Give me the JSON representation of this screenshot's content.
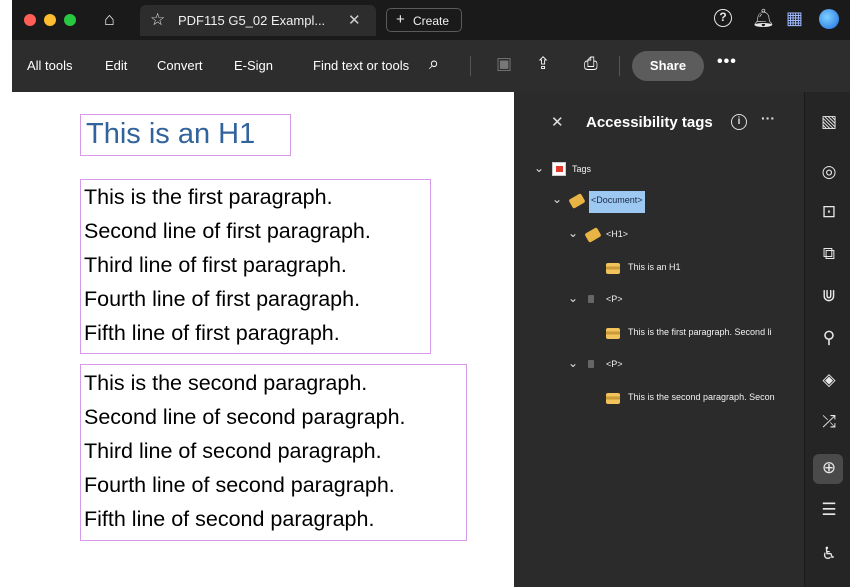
{
  "tabbar": {
    "tab_title": "PDF115 G5_02 Exampl...",
    "create_label": "Create",
    "help_glyph": "?"
  },
  "toolbar": {
    "all_tools": "All tools",
    "edit": "Edit",
    "convert": "Convert",
    "esign": "E-Sign",
    "find_text": "Find text or tools",
    "share": "Share"
  },
  "document": {
    "heading": "This is an H1",
    "paragraph1": [
      "This is the first paragraph.",
      "Second line of first paragraph.",
      "Third line of first paragraph.",
      "Fourth line of first paragraph.",
      "Fifth line of first paragraph."
    ],
    "paragraph2": [
      "This is the second paragraph.",
      "Second line of second paragraph.",
      "Third line of second paragraph.",
      "Fourth line of second paragraph.",
      "Fifth line of second paragraph."
    ]
  },
  "panel": {
    "title": "Accessibility tags",
    "info_glyph": "i",
    "tree": {
      "tags": "Tags",
      "document": "<Document>",
      "h1": "<H1>",
      "h1_text": "This is an H1",
      "p1": "<P>",
      "p1_text": "This is the first paragraph. Second li",
      "p2": "<P>",
      "p2_text": "This is the second paragraph. Secon"
    }
  },
  "icons": [
    "home-icon",
    "star-icon",
    "close-icon",
    "plus-icon",
    "help-icon",
    "bell-icon",
    "apps-icon",
    "profile-icon",
    "search-icon",
    "save-icon",
    "upload-icon",
    "print-icon",
    "more-icon",
    "info-icon",
    "chevron-down-icon",
    "pdf-icon",
    "tag-icon",
    "content-icon"
  ],
  "colors": {
    "accent_heading": "#31639c",
    "tag_box_border": "#d69ae6",
    "selected_tag": "#9cc8f2"
  }
}
